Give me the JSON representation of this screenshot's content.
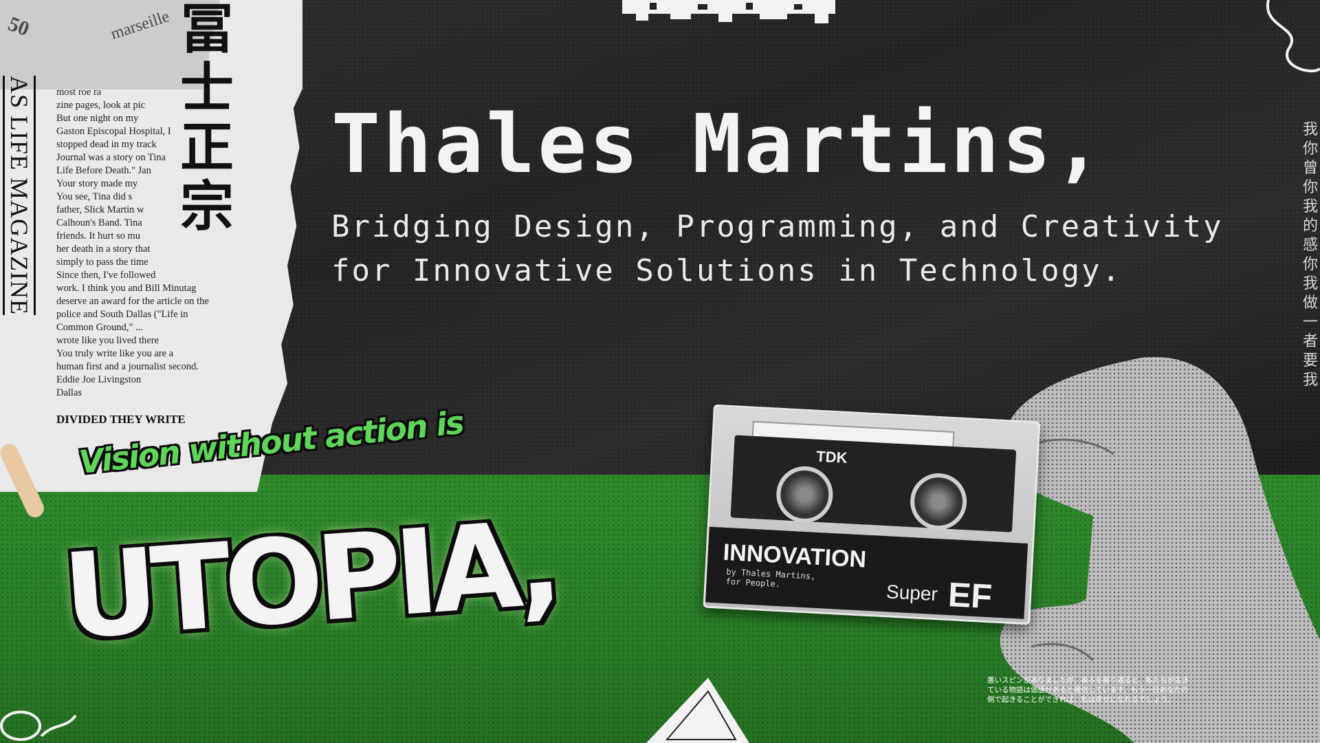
{
  "hero": {
    "name": "Thales Martins,",
    "tagline_line1": "Bridging Design, Programming, and Creativity",
    "tagline_line2": "for Innovative Solutions in Technology."
  },
  "newspaper": {
    "magazine_title": "AS LIFE MAGAZINE",
    "kanji": "冨士正宗",
    "stamp_number": "50",
    "stamp_word": "marseille",
    "body": "most roe ra\nzine pages, look at pic\nBut one night on my\nGaston Episcopal Hospital, I\nstopped dead in my track\nJournal was a story on Tina\nLife Before Death.\" Jan\nYour story made my\nYou see, Tina did s\nfather, Slick Martin w\nCalhoun's Band. Tina\nfriends. It hurt so mu\nher death in a story that\nsimply to pass the time\nSince then, I've followed\nwork. I think you and Bill Minutag\ndeserve an award for the article on the\npolice and South Dallas (\"Life in\nCommon Ground,\" ...\nwrote like you lived there\nYou truly write like you are a\nhuman first and a journalist second.\nEddie Joe Livingston\nDallas",
    "section_heading": "DIVIDED THEY WRITE"
  },
  "graffiti": {
    "tagline": "Vision without action is",
    "word": "UTOPIA,"
  },
  "cassette": {
    "brand": "TDK",
    "title": "INNOVATION",
    "byline": "by Thales Martins,\nfor People.",
    "super": "Super",
    "ef": "EF"
  },
  "notes": {
    "japanese": "悪いスピンがありましたが、後ろを振り返ると、私たちが生きている物語は価値があると確信しています。もう一日あなたの側で起きることができれば、私は幸せになれるでしょう。",
    "vertical_chinese": "我你曾你我的，感你我做一，者，要我"
  },
  "colors": {
    "dark_bg": "#262626",
    "green_bg": "#2d8a2a",
    "accent_green": "#5fd659",
    "text_light": "#f3f3f3"
  }
}
